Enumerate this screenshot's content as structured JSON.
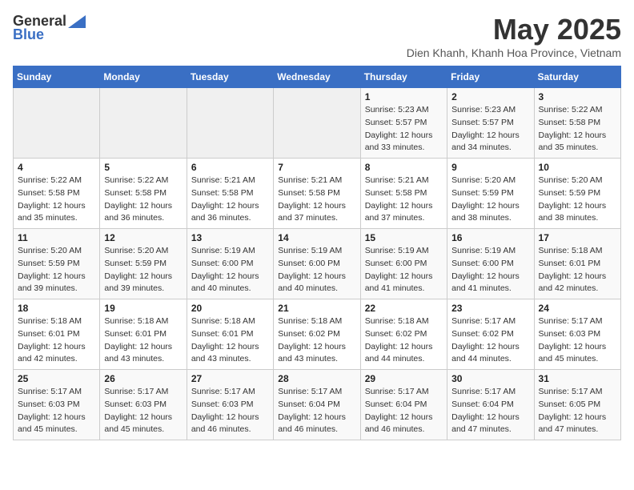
{
  "logo": {
    "general": "General",
    "blue": "Blue"
  },
  "title": "May 2025",
  "subtitle": "Dien Khanh, Khanh Hoa Province, Vietnam",
  "days_of_week": [
    "Sunday",
    "Monday",
    "Tuesday",
    "Wednesday",
    "Thursday",
    "Friday",
    "Saturday"
  ],
  "weeks": [
    [
      {
        "day": "",
        "info": ""
      },
      {
        "day": "",
        "info": ""
      },
      {
        "day": "",
        "info": ""
      },
      {
        "day": "",
        "info": ""
      },
      {
        "day": "1",
        "info": "Sunrise: 5:23 AM\nSunset: 5:57 PM\nDaylight: 12 hours\nand 33 minutes."
      },
      {
        "day": "2",
        "info": "Sunrise: 5:23 AM\nSunset: 5:57 PM\nDaylight: 12 hours\nand 34 minutes."
      },
      {
        "day": "3",
        "info": "Sunrise: 5:22 AM\nSunset: 5:58 PM\nDaylight: 12 hours\nand 35 minutes."
      }
    ],
    [
      {
        "day": "4",
        "info": "Sunrise: 5:22 AM\nSunset: 5:58 PM\nDaylight: 12 hours\nand 35 minutes."
      },
      {
        "day": "5",
        "info": "Sunrise: 5:22 AM\nSunset: 5:58 PM\nDaylight: 12 hours\nand 36 minutes."
      },
      {
        "day": "6",
        "info": "Sunrise: 5:21 AM\nSunset: 5:58 PM\nDaylight: 12 hours\nand 36 minutes."
      },
      {
        "day": "7",
        "info": "Sunrise: 5:21 AM\nSunset: 5:58 PM\nDaylight: 12 hours\nand 37 minutes."
      },
      {
        "day": "8",
        "info": "Sunrise: 5:21 AM\nSunset: 5:58 PM\nDaylight: 12 hours\nand 37 minutes."
      },
      {
        "day": "9",
        "info": "Sunrise: 5:20 AM\nSunset: 5:59 PM\nDaylight: 12 hours\nand 38 minutes."
      },
      {
        "day": "10",
        "info": "Sunrise: 5:20 AM\nSunset: 5:59 PM\nDaylight: 12 hours\nand 38 minutes."
      }
    ],
    [
      {
        "day": "11",
        "info": "Sunrise: 5:20 AM\nSunset: 5:59 PM\nDaylight: 12 hours\nand 39 minutes."
      },
      {
        "day": "12",
        "info": "Sunrise: 5:20 AM\nSunset: 5:59 PM\nDaylight: 12 hours\nand 39 minutes."
      },
      {
        "day": "13",
        "info": "Sunrise: 5:19 AM\nSunset: 6:00 PM\nDaylight: 12 hours\nand 40 minutes."
      },
      {
        "day": "14",
        "info": "Sunrise: 5:19 AM\nSunset: 6:00 PM\nDaylight: 12 hours\nand 40 minutes."
      },
      {
        "day": "15",
        "info": "Sunrise: 5:19 AM\nSunset: 6:00 PM\nDaylight: 12 hours\nand 41 minutes."
      },
      {
        "day": "16",
        "info": "Sunrise: 5:19 AM\nSunset: 6:00 PM\nDaylight: 12 hours\nand 41 minutes."
      },
      {
        "day": "17",
        "info": "Sunrise: 5:18 AM\nSunset: 6:01 PM\nDaylight: 12 hours\nand 42 minutes."
      }
    ],
    [
      {
        "day": "18",
        "info": "Sunrise: 5:18 AM\nSunset: 6:01 PM\nDaylight: 12 hours\nand 42 minutes."
      },
      {
        "day": "19",
        "info": "Sunrise: 5:18 AM\nSunset: 6:01 PM\nDaylight: 12 hours\nand 43 minutes."
      },
      {
        "day": "20",
        "info": "Sunrise: 5:18 AM\nSunset: 6:01 PM\nDaylight: 12 hours\nand 43 minutes."
      },
      {
        "day": "21",
        "info": "Sunrise: 5:18 AM\nSunset: 6:02 PM\nDaylight: 12 hours\nand 43 minutes."
      },
      {
        "day": "22",
        "info": "Sunrise: 5:18 AM\nSunset: 6:02 PM\nDaylight: 12 hours\nand 44 minutes."
      },
      {
        "day": "23",
        "info": "Sunrise: 5:17 AM\nSunset: 6:02 PM\nDaylight: 12 hours\nand 44 minutes."
      },
      {
        "day": "24",
        "info": "Sunrise: 5:17 AM\nSunset: 6:03 PM\nDaylight: 12 hours\nand 45 minutes."
      }
    ],
    [
      {
        "day": "25",
        "info": "Sunrise: 5:17 AM\nSunset: 6:03 PM\nDaylight: 12 hours\nand 45 minutes."
      },
      {
        "day": "26",
        "info": "Sunrise: 5:17 AM\nSunset: 6:03 PM\nDaylight: 12 hours\nand 45 minutes."
      },
      {
        "day": "27",
        "info": "Sunrise: 5:17 AM\nSunset: 6:03 PM\nDaylight: 12 hours\nand 46 minutes."
      },
      {
        "day": "28",
        "info": "Sunrise: 5:17 AM\nSunset: 6:04 PM\nDaylight: 12 hours\nand 46 minutes."
      },
      {
        "day": "29",
        "info": "Sunrise: 5:17 AM\nSunset: 6:04 PM\nDaylight: 12 hours\nand 46 minutes."
      },
      {
        "day": "30",
        "info": "Sunrise: 5:17 AM\nSunset: 6:04 PM\nDaylight: 12 hours\nand 47 minutes."
      },
      {
        "day": "31",
        "info": "Sunrise: 5:17 AM\nSunset: 6:05 PM\nDaylight: 12 hours\nand 47 minutes."
      }
    ]
  ]
}
